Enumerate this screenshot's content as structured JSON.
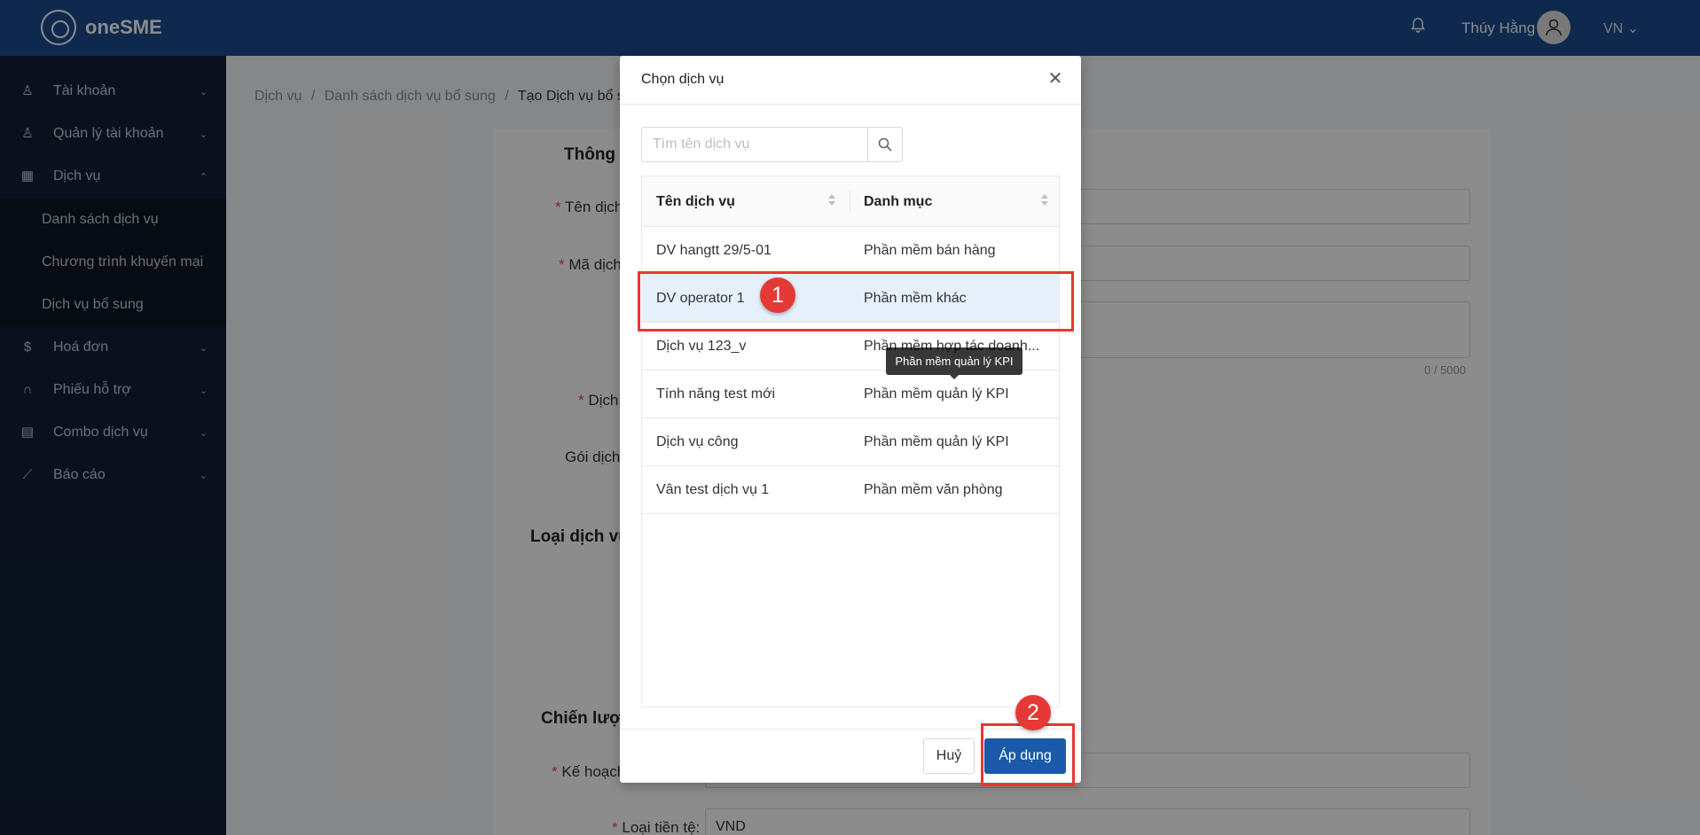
{
  "app": {
    "name": "oneSME"
  },
  "header": {
    "username": "Thúy Hằng",
    "language": "VN",
    "language_chevron": "⌄"
  },
  "sidebar": {
    "items": [
      {
        "label": "Tài khoản",
        "icon": "user-icon",
        "glyph": "♙",
        "chevron": "⌄"
      },
      {
        "label": "Quản lý tài khoản",
        "icon": "user-icon",
        "glyph": "♙",
        "chevron": "⌄"
      },
      {
        "label": "Dịch vụ",
        "icon": "grid-icon",
        "glyph": "▦",
        "chevron": "⌃"
      },
      {
        "label": "Hoá đơn",
        "icon": "dollar-icon",
        "glyph": "$",
        "chevron": "⌄"
      },
      {
        "label": "Phiếu hỗ trợ",
        "icon": "headset-icon",
        "glyph": "∩",
        "chevron": "⌄"
      },
      {
        "label": "Combo dịch vụ",
        "icon": "calendar-icon",
        "glyph": "▤",
        "chevron": "⌄"
      },
      {
        "label": "Báo cáo",
        "icon": "chart-icon",
        "glyph": "⟋",
        "chevron": "⌄"
      }
    ],
    "sub_items": [
      {
        "label": "Danh sách dịch vụ"
      },
      {
        "label": "Chương trình khuyến mại"
      },
      {
        "label": "Dịch vụ bổ sung"
      }
    ]
  },
  "breadcrumb": {
    "items": [
      "Dịch vụ",
      "Danh sách dịch vụ bổ sung",
      "Tạo Dịch vụ bổ su"
    ],
    "separator": "/"
  },
  "form": {
    "section_info": "Thông",
    "label_name": "Tên dịch",
    "label_code": "Mã dịch",
    "counter": "0 / 5000",
    "label_service": "Dịch",
    "label_package": "Gói dịch",
    "section_type": "Loại dịch vụ",
    "section_strategy": "Chiến lượ",
    "label_plan": "Kế hoạch",
    "label_currency": "Loại tiền tệ:",
    "currency_value": "VND",
    "required_mark": "*"
  },
  "modal": {
    "title": "Chọn dịch vụ",
    "close_glyph": "✕",
    "search_placeholder": "Tìm tên dịch vụ",
    "columns": [
      "Tên dịch vụ",
      "Danh mục"
    ],
    "rows": [
      {
        "name": "DV hangtt 29/5-01",
        "category": "Phần mềm bán hàng"
      },
      {
        "name": "DV operator 1",
        "category": "Phần mềm khác",
        "selected": true
      },
      {
        "name": "Dịch vụ 123_v",
        "category": "Phần mềm hợp tác doanh..."
      },
      {
        "name": "Tính năng test mới",
        "category": "Phần mềm quản lý KPI"
      },
      {
        "name": "Dịch vụ công",
        "category": "Phần mềm quản lý KPI"
      },
      {
        "name": "Vân test dịch vụ 1",
        "category": "Phần mềm văn phòng"
      }
    ],
    "tooltip": "Phần mềm quản lý KPI",
    "cancel_label": "Huỷ",
    "apply_label": "Áp dụng"
  },
  "annotations": {
    "marker_1": "1",
    "marker_2": "2"
  },
  "colors": {
    "header": "#1a4b8c",
    "sidebar": "#0f2036",
    "primary": "#1a5aa8",
    "highlight": "#e53935",
    "selected_row": "#e6f0fb"
  }
}
